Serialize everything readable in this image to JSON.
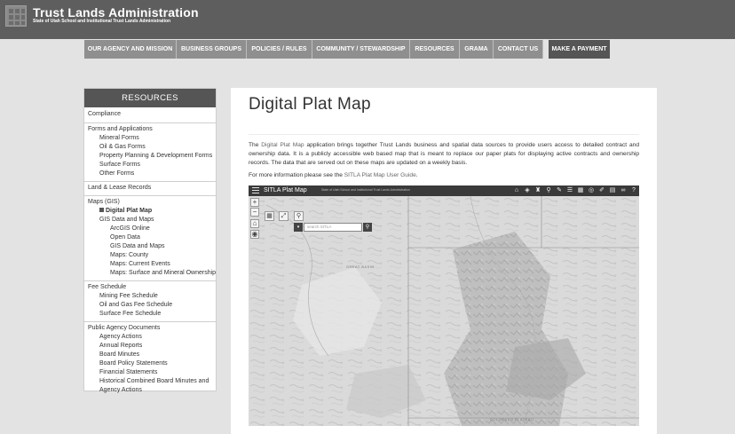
{
  "header": {
    "org_name": "Trust Lands Administration",
    "org_subtitle": "State of Utah School and Institutional Trust Lands Administration"
  },
  "nav": [
    {
      "label": "OUR AGENCY AND MISSION"
    },
    {
      "label": "BUSINESS GROUPS"
    },
    {
      "label": "POLICIES / RULES"
    },
    {
      "label": "COMMUNITY / STEWARDSHIP"
    },
    {
      "label": "RESOURCES"
    },
    {
      "label": "GRAMA"
    },
    {
      "label": "CONTACT US"
    },
    {
      "label": "MAKE A PAYMENT"
    }
  ],
  "sidebar": {
    "heading": "RESOURCES",
    "items": {
      "compliance": "Compliance",
      "forms": "Forms and Applications",
      "mineral_forms": "Mineral Forms",
      "oil_gas_forms": "Oil & Gas Forms",
      "property_forms": "Property Planning & Development Forms",
      "surface_forms": "Surface Forms",
      "other_forms": "Other Forms",
      "land_records": "Land & Lease Records",
      "maps_gis": "Maps (GIS)",
      "digital_plat": "Digital Plat Map",
      "gis_data_maps": "GIS Data and Maps",
      "arcgis": "ArcGIS Online",
      "open_data": "Open Data",
      "gis_data_maps2": "GIS Data and Maps",
      "maps_county": "Maps: County",
      "maps_events": "Maps: Current Events",
      "maps_surface": "Maps: Surface and Mineral Ownership",
      "fee_schedule": "Fee Schedule",
      "mining_fee": "Mining Fee Schedule",
      "oil_gas_fee": "Oil and Gas Fee Schedule",
      "surface_fee": "Surface Fee Schedule",
      "public_docs": "Public Agency Documents",
      "agency_actions": "Agency Actions",
      "annual_reports": "Annual Reports",
      "board_minutes": "Board Minutes",
      "board_policy": "Board Policy Statements",
      "financial": "Financial Statements",
      "historical": "Historical Combined Board Minutes and",
      "historical2": "Agency Actions"
    }
  },
  "content": {
    "title": "Digital Plat Map",
    "desc_pre": "The ",
    "desc_link": "Digital Plat Map",
    "desc_post": " application brings together Trust Lands business and spatial data sources to provide users access to detailed contract and ownership data. It is a publicly accessible web based map that is meant to replace our paper plats for displaying active contracts and ownership records. The data that are served out on these maps are updated on a weekly basis.",
    "more_pre": "For more information please see the ",
    "more_link": "SITLA Plat Map User Guide",
    "more_post": "."
  },
  "map": {
    "title": "SITLA Plat Map",
    "subtitle": "State of Utah School and Institutional Trust Lands Administration",
    "search_placeholder": "search SITLA",
    "labels": {
      "great_basin": "GREAT BASIN",
      "colorado_plateau": "COLORADO PLATEAU"
    },
    "tool_icons": [
      "home-icon",
      "layers-icon",
      "tower-icon",
      "pin-icon",
      "draw-icon",
      "list-icon",
      "grid-icon",
      "globe-icon",
      "edit-icon",
      "print-icon",
      "link-icon",
      "help-icon"
    ]
  },
  "colors": {
    "header_bg": "#5e5e5e",
    "nav_bg": "#8f8f8f",
    "nav_active_bg": "#555555",
    "sidebar_head_bg": "#555555",
    "page_bg": "#e3e3e3"
  }
}
